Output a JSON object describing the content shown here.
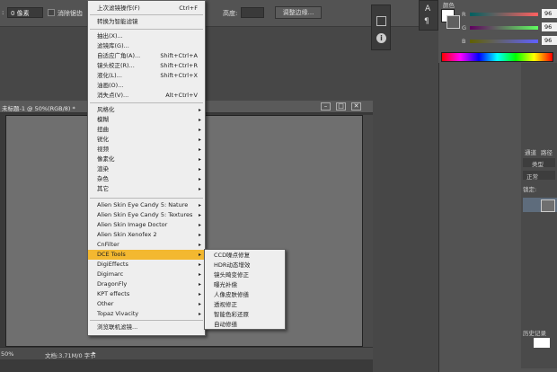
{
  "options_bar": {
    "size_value": "0 像素",
    "antialias_label": "消除锯齿",
    "height_label": "高度:",
    "refine_edge_button": "调整边缘..."
  },
  "document": {
    "title": "未标题-1 @ 50%(RGB/8) *",
    "zoom": "50%",
    "doc_info": "文档:3.71M/0 字节"
  },
  "filter_menu": {
    "items": [
      {
        "label": "上次滤镜操作(F)",
        "shortcut": "Ctrl+F"
      },
      {
        "label": "转换为智能滤镜",
        "shortcut": ""
      },
      {
        "label": "抽出(X)...",
        "shortcut": ""
      },
      {
        "label": "滤镜库(G)...",
        "shortcut": ""
      },
      {
        "label": "自适应广角(A)...",
        "shortcut": "Shift+Ctrl+A"
      },
      {
        "label": "镜头校正(R)...",
        "shortcut": "Shift+Ctrl+R"
      },
      {
        "label": "液化(L)...",
        "shortcut": "Shift+Ctrl+X"
      },
      {
        "label": "油画(O)...",
        "shortcut": ""
      },
      {
        "label": "消失点(V)...",
        "shortcut": "Alt+Ctrl+V"
      },
      {
        "label": "风格化"
      },
      {
        "label": "模糊"
      },
      {
        "label": "扭曲"
      },
      {
        "label": "锐化"
      },
      {
        "label": "视频"
      },
      {
        "label": "像素化"
      },
      {
        "label": "渲染"
      },
      {
        "label": "杂色"
      },
      {
        "label": "其它"
      },
      {
        "label": "Alien Skin Eye Candy 5: Nature"
      },
      {
        "label": "Alien Skin Eye Candy 5: Textures"
      },
      {
        "label": "Alien Skin Image Doctor"
      },
      {
        "label": "Alien Skin Xenofex 2"
      },
      {
        "label": "CnFilter"
      },
      {
        "label": "DCE Tools"
      },
      {
        "label": "DigiEffects"
      },
      {
        "label": "Digimarc"
      },
      {
        "label": "DragonFly"
      },
      {
        "label": "KPT effects"
      },
      {
        "label": "Other"
      },
      {
        "label": "Topaz Vivacity"
      },
      {
        "label": "浏览联机滤镜..."
      }
    ]
  },
  "submenu": {
    "items": [
      "CCD噪点修复",
      "HDR动态增效",
      "镜头畸变修正",
      "曝光补偿",
      "人像皮肤修缮",
      "透视修正",
      "智能色彩还原",
      "自动修缮"
    ]
  },
  "color_panel": {
    "tab": "颜色",
    "r_label": "R",
    "r_value": "96",
    "g_label": "G",
    "g_value": "96",
    "b_label": "B",
    "b_value": "96"
  },
  "layers_panel": {
    "tabs": [
      "通道",
      "路径"
    ],
    "filter_label": "类型",
    "blend_mode": "正常",
    "lock_label": "锁定:",
    "history_tab": "历史记录"
  },
  "colors": {
    "menu_bg": "#eeeeee",
    "highlight": "#f3b830",
    "panel_bg": "#535353"
  }
}
